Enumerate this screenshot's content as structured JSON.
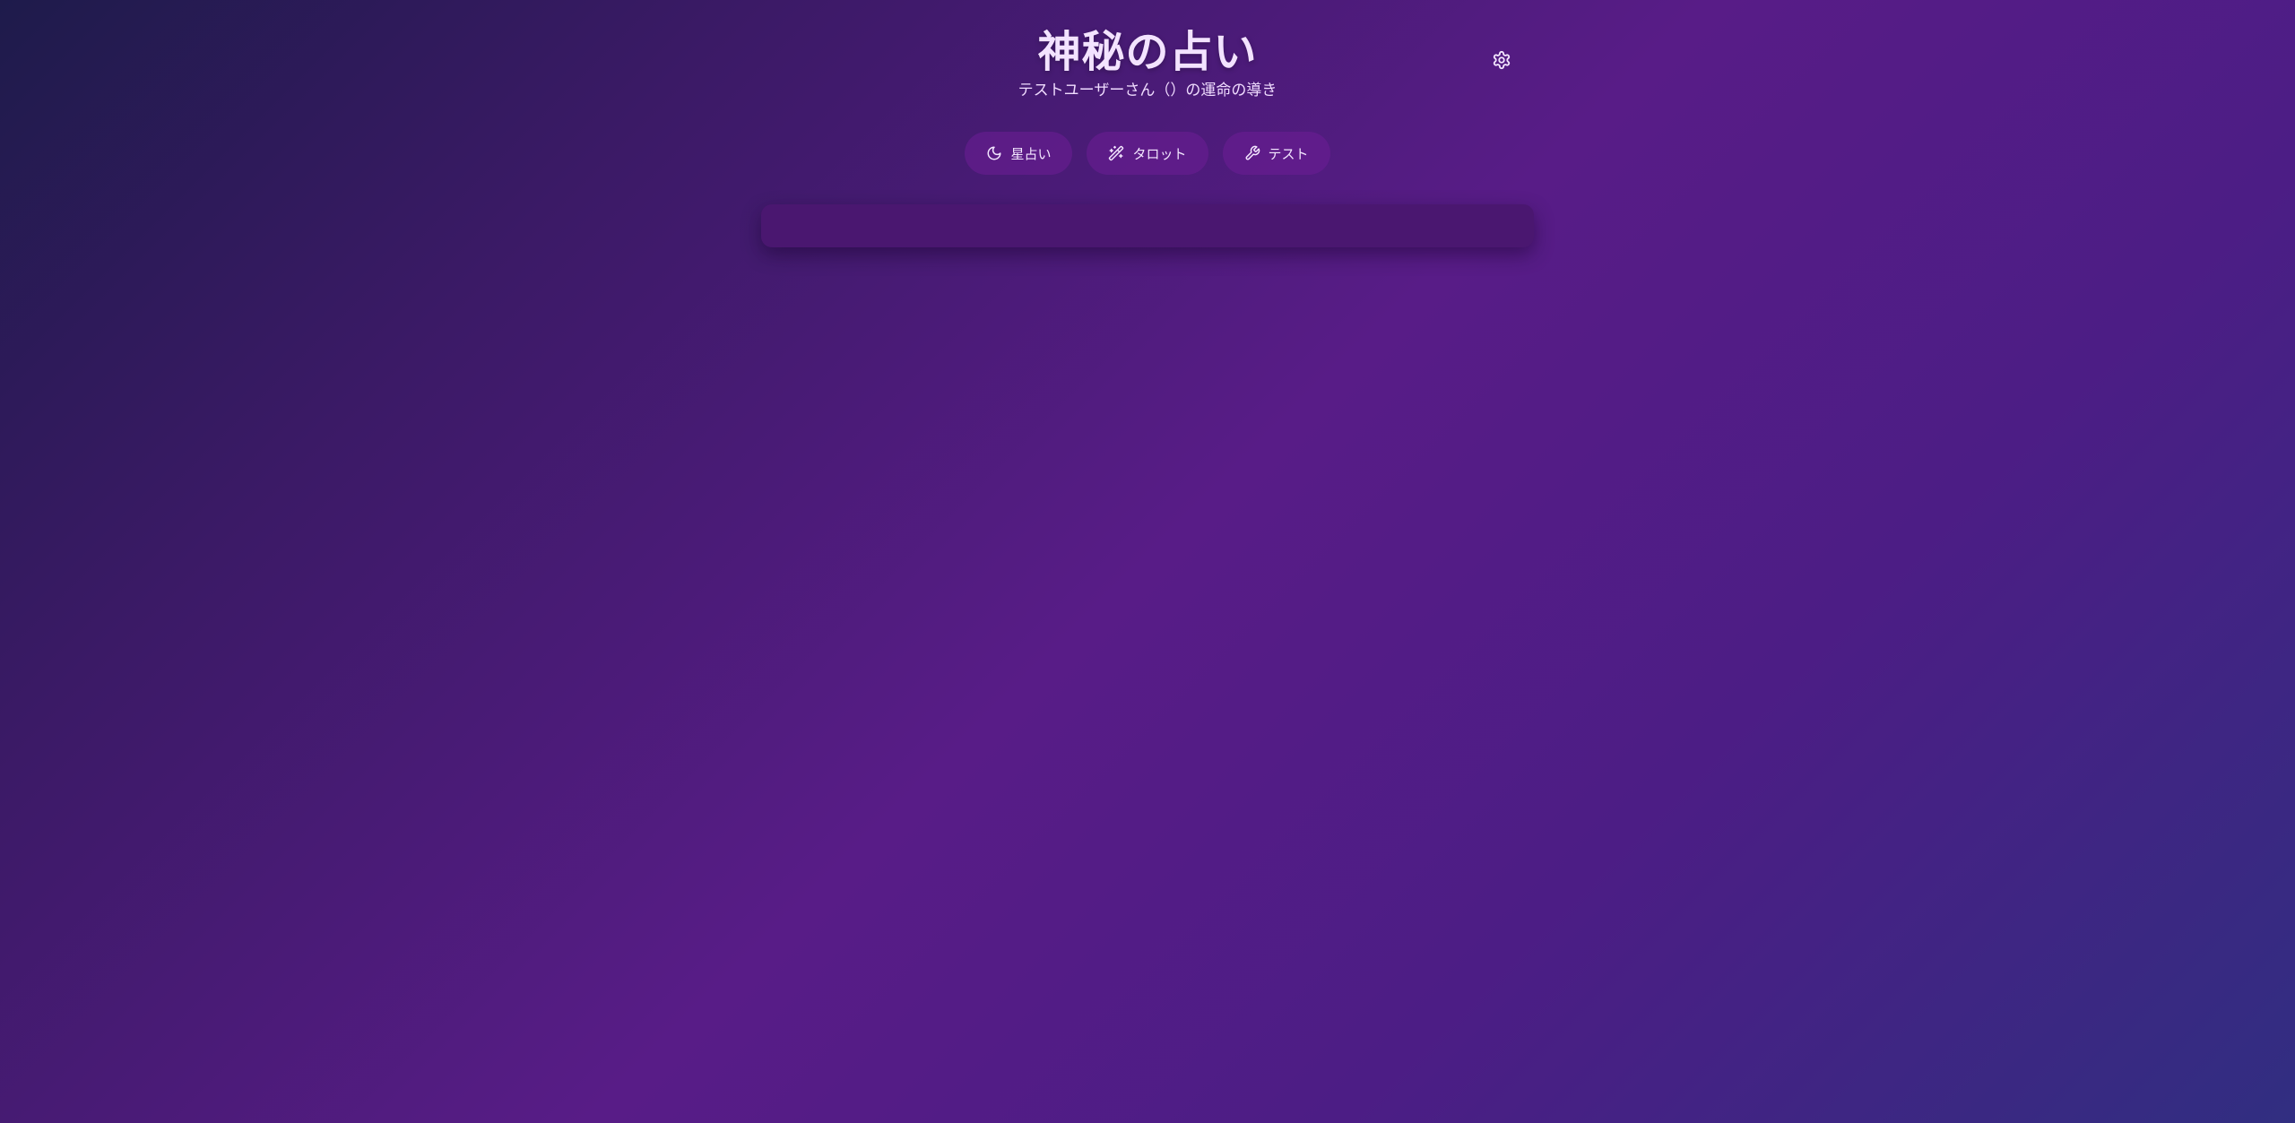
{
  "header": {
    "title": "神秘の占い",
    "subtitle": "テストユーザーさん（）の運命の導き",
    "settings_icon": "gear-icon"
  },
  "nav": {
    "tabs": [
      {
        "label": "星占い",
        "icon": "moon-icon"
      },
      {
        "label": "タロット",
        "icon": "sparkle-wand-icon"
      },
      {
        "label": "テスト",
        "icon": "wrench-icon"
      }
    ]
  },
  "theme": {
    "gradient": [
      "#1e1b4b",
      "#581c87",
      "#312e81"
    ],
    "nav_button_bg": "#6e1e96",
    "card_bg": "#4a1770",
    "text": "#f3e3ff"
  }
}
